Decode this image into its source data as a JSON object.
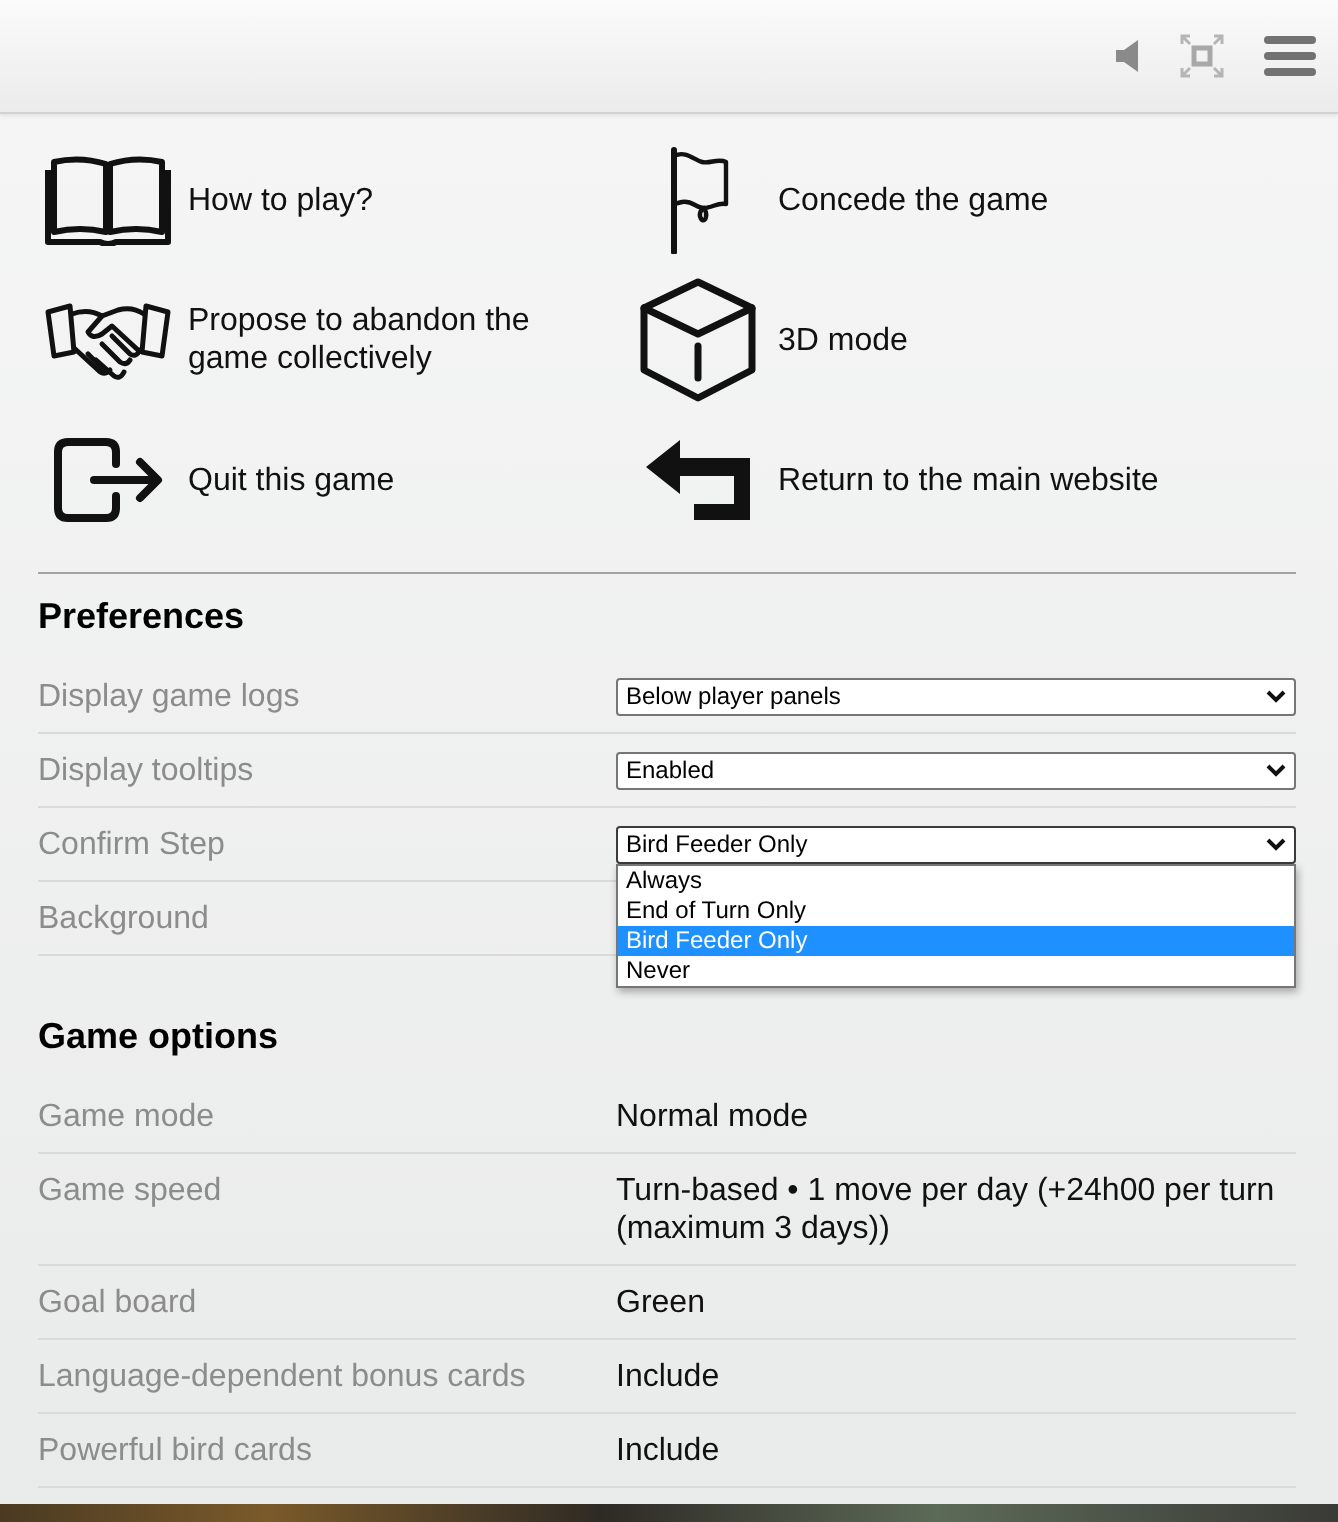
{
  "actions": [
    {
      "label": "How to play?"
    },
    {
      "label": "Concede the game"
    },
    {
      "label": "Propose to abandon the game collectively"
    },
    {
      "label": "3D mode"
    },
    {
      "label": "Quit this game"
    },
    {
      "label": "Return to the main website"
    }
  ],
  "preferences": {
    "title": "Preferences",
    "rows": [
      {
        "label": "Display game logs",
        "value": "Below player panels",
        "expanded": false
      },
      {
        "label": "Display tooltips",
        "value": "Enabled",
        "expanded": false
      },
      {
        "label": "Confirm Step",
        "value": "Bird Feeder Only",
        "expanded": true,
        "options": [
          {
            "label": "Always",
            "selected": false
          },
          {
            "label": "End of Turn Only",
            "selected": false
          },
          {
            "label": "Bird Feeder Only",
            "selected": true
          },
          {
            "label": "Never",
            "selected": false
          }
        ]
      },
      {
        "label": "Background"
      }
    ]
  },
  "game_options": {
    "title": "Game options",
    "rows": [
      {
        "label": "Game mode",
        "value": "Normal mode"
      },
      {
        "label": "Game speed",
        "value": "Turn-based • 1 move per day (+24h00 per turn (maximum 3 days))"
      },
      {
        "label": "Goal board",
        "value": "Green"
      },
      {
        "label": "Language-dependent bonus cards",
        "value": "Include"
      },
      {
        "label": "Powerful bird cards",
        "value": "Include"
      }
    ]
  }
}
